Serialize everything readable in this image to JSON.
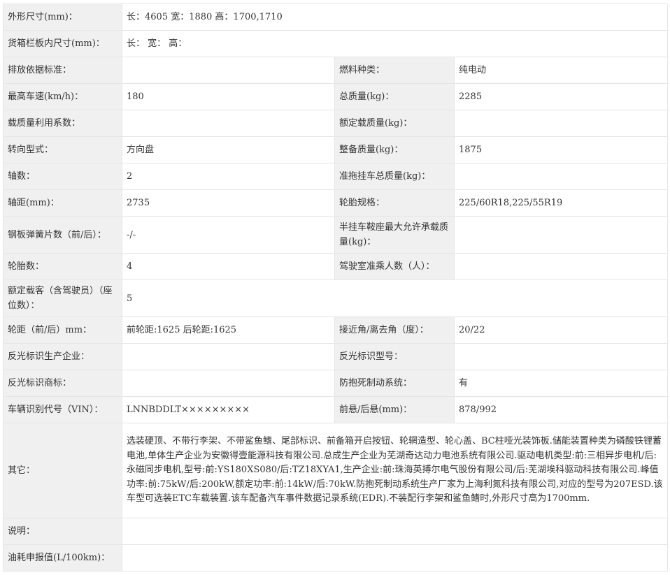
{
  "rows": {
    "r1": {
      "label": "外形尺寸(mm)：",
      "value": "长：4605 宽：1880 高：1700,1710"
    },
    "r2": {
      "label": "货箱栏板内尺寸(mm)：",
      "value": "长： 宽： 高："
    },
    "r3": {
      "label1": "排放依据标准：",
      "value1": "",
      "label2": "燃料种类：",
      "value2": "纯电动"
    },
    "r4": {
      "label1": "最高车速(km/h)：",
      "value1": "180",
      "label2": "总质量(kg)：",
      "value2": "2285"
    },
    "r5": {
      "label1": "载质量利用系数：",
      "value1": "",
      "label2": "额定载质量(kg)：",
      "value2": ""
    },
    "r6": {
      "label1": "转向型式：",
      "value1": "方向盘",
      "label2": "整备质量(kg)：",
      "value2": "1875"
    },
    "r7": {
      "label1": "轴数：",
      "value1": "2",
      "label2": "准拖挂车总质量(kg)：",
      "value2": ""
    },
    "r8": {
      "label1": "轴距(mm)：",
      "value1": "2735",
      "label2": "轮胎规格：",
      "value2": "225/60R18,225/55R19"
    },
    "r9": {
      "label1": "钢板弹簧片数（前/后）：",
      "value1": "-/-",
      "label2": "半挂车鞍座最大允许承载质量(kg)：",
      "value2": ""
    },
    "r10": {
      "label1": "轮胎数：",
      "value1": "4",
      "label2": "驾驶室准乘人数（人）：",
      "value2": ""
    },
    "r11": {
      "label": "额定载客（含驾驶员）（座位数）：",
      "value": "5"
    },
    "r12": {
      "label1": "轮距（前/后）mm：",
      "value1": "前轮距:1625 后轮距:1625",
      "label2": "接近角/离去角（度）：",
      "value2": "20/22"
    },
    "r13": {
      "label1": "反光标识生产企业：",
      "value1": "",
      "label2": "反光标识型号：",
      "value2": ""
    },
    "r14": {
      "label1": "反光标识商标：",
      "value1": "",
      "label2": "防抱死制动系统：",
      "value2": "有"
    },
    "r15": {
      "label1": "车辆识别代号（VIN）：",
      "value1": "LNNBDDLT×××××××××",
      "label2": "前悬/后悬(mm)：",
      "value2": "878/992"
    },
    "r16": {
      "label": "其它：",
      "value": "选装硬顶、不带行李架、不带鲨鱼鳍、尾部标识、前备箱开启按钮、轮辋造型、轮心盖、BC柱哑光装饰板.储能装置种类为磷酸铁锂蓄电池,单体生产企业为安徽得壹能源科技有限公司.总成生产企业为芜湖奇达动力电池系统有限公司.驱动电机类型:前:三相异步电机/后:永磁同步电机,型号:前:YS180XS080/后:TZ18XYA1,生产企业:前:珠海英搏尔电气股份有限公司/后:芜湖埃科驱动科技有限公司.峰值功率:前:75kW/后:200kW,额定功率:前:14kW/后:70kW.防抱死制动系统生产厂家为上海利氮科技有限公司,对应的型号为207ESD.该车型可选装ETC车载装置.该车配备汽车事件数据记录系统(EDR).不装配行李架和鲨鱼鳍时,外形尺寸高为1700mm."
    },
    "r17": {
      "label": "说明：",
      "value": ""
    },
    "r18": {
      "label": "油耗申报值(L/100km)：",
      "value": ""
    }
  }
}
